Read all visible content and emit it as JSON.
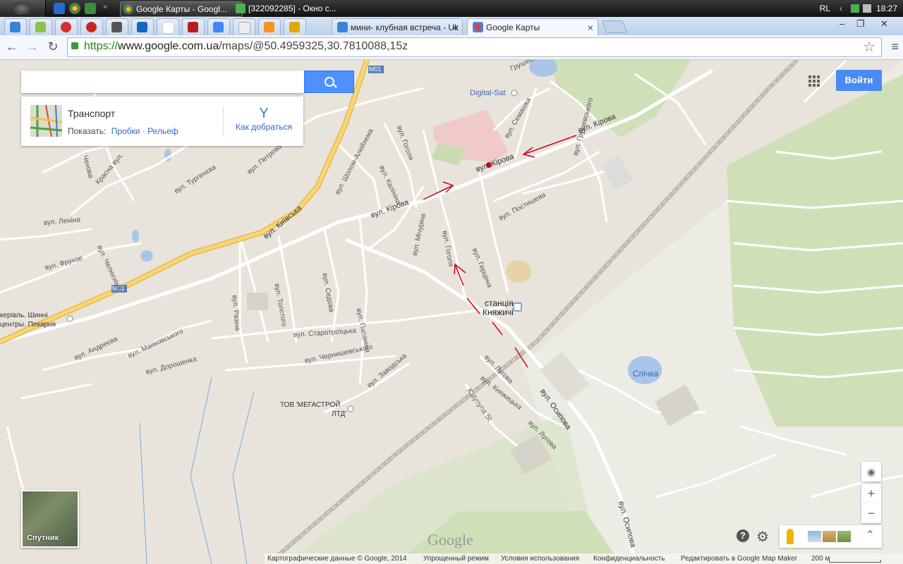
{
  "taskbar": {
    "tasks": [
      {
        "label": "Google Карты - Googl...",
        "active": true
      },
      {
        "label": "[322092285] - Окно с..."
      }
    ],
    "tray_lang": "RL",
    "clock": "18:27"
  },
  "browser": {
    "tabs": [
      {
        "label": "мини- клубная встреча - Uk"
      },
      {
        "label": "Google Карты",
        "selected": true
      }
    ],
    "url_scheme": "https://",
    "url_host": "www.google.com.ua",
    "url_path": "/maps/@50.4959325,30.7810088,15z"
  },
  "search": {
    "placeholder": ""
  },
  "panel": {
    "title": "Транспорт",
    "show_label": "Показать:",
    "traffic": "Пробки",
    "sep": "·",
    "relief": "Рельеф",
    "directions": "Как добраться"
  },
  "signin": "Войти",
  "satellite": "Спутник",
  "zoom": {
    "plus": "+",
    "minus": "−"
  },
  "help": "?",
  "logo": "Google",
  "map_labels": {
    "kirova1": "вул. Кірова",
    "kirova2": "вул. Кірова",
    "kirova3": "вул. Кірова",
    "kyivska": "вул. Київська",
    "m01a": "M01",
    "m01b": "M01",
    "digitalsat": "Digital-Sat",
    "station1": "станція",
    "station2": "Княжичі",
    "spichka": "Спічка",
    "megastroy1": "ТОВ 'МЕГАСТРОЙ",
    "megastroy2": "ЛТД'",
    "osypova1": "вул. Осипова",
    "osypova2": "вул. Осипова",
    "gogolya1": "вул. Гоголя",
    "gogolya2": "вул. Гоголя",
    "semashka": "вул. Семашка",
    "grushevskogo1": "вул. Грушевського",
    "grushevskogo2": "Грушевського",
    "postysheva": "вул. Постишева",
    "gertsena": "вул. Герцена",
    "michurina": "вул. Мічуріна",
    "kalinina": "вул. Калініна",
    "sholom": "вул. Шолом-Алейхема",
    "petrova": "вул. Петрова",
    "turgeneva": "вул. Тургенєва",
    "krasna": "Красна вул.",
    "chekhova": "Чехова",
    "lenina": "вул. Леніна",
    "frunze": "вул. Фрунзе",
    "chelyuskina": "вул. Челюскіна",
    "tolstogo": "вул. Толстого",
    "razina": "вул. Разіна",
    "sedova": "вул. Седова",
    "papanina": "вул. Папаніна",
    "starotroitska": "вул. Старотроїцька",
    "chernyshevskogo": "вул. Чернишевського",
    "zavodska": "вул. Заводська",
    "andreeva": "вул. Андреєва",
    "mayakovskogo": "вул. Маяковського",
    "doroshenka": "вул. Дорошенка",
    "lugova1": "вул. Лугова",
    "lugova2": "вул. Лугова",
    "knyazhytska": "вул. Княжицька",
    "kalynova": "Kalynyna St",
    "shynne1": "керівль. Шинні",
    "shynne2": "центры. Пекарня"
  },
  "footer": {
    "copyright": "Картографические данные © Google, 2014",
    "lite": "Упрощенный режим",
    "terms": "Условия использования",
    "privacy": "Конфиденциальность",
    "mapmaker": "Редактировать в Google Map Maker",
    "scale": "200 м"
  },
  "colors": {
    "accent": "#4a8af4",
    "highway": "#f7c95b",
    "route_arrows": "#d0021b"
  }
}
